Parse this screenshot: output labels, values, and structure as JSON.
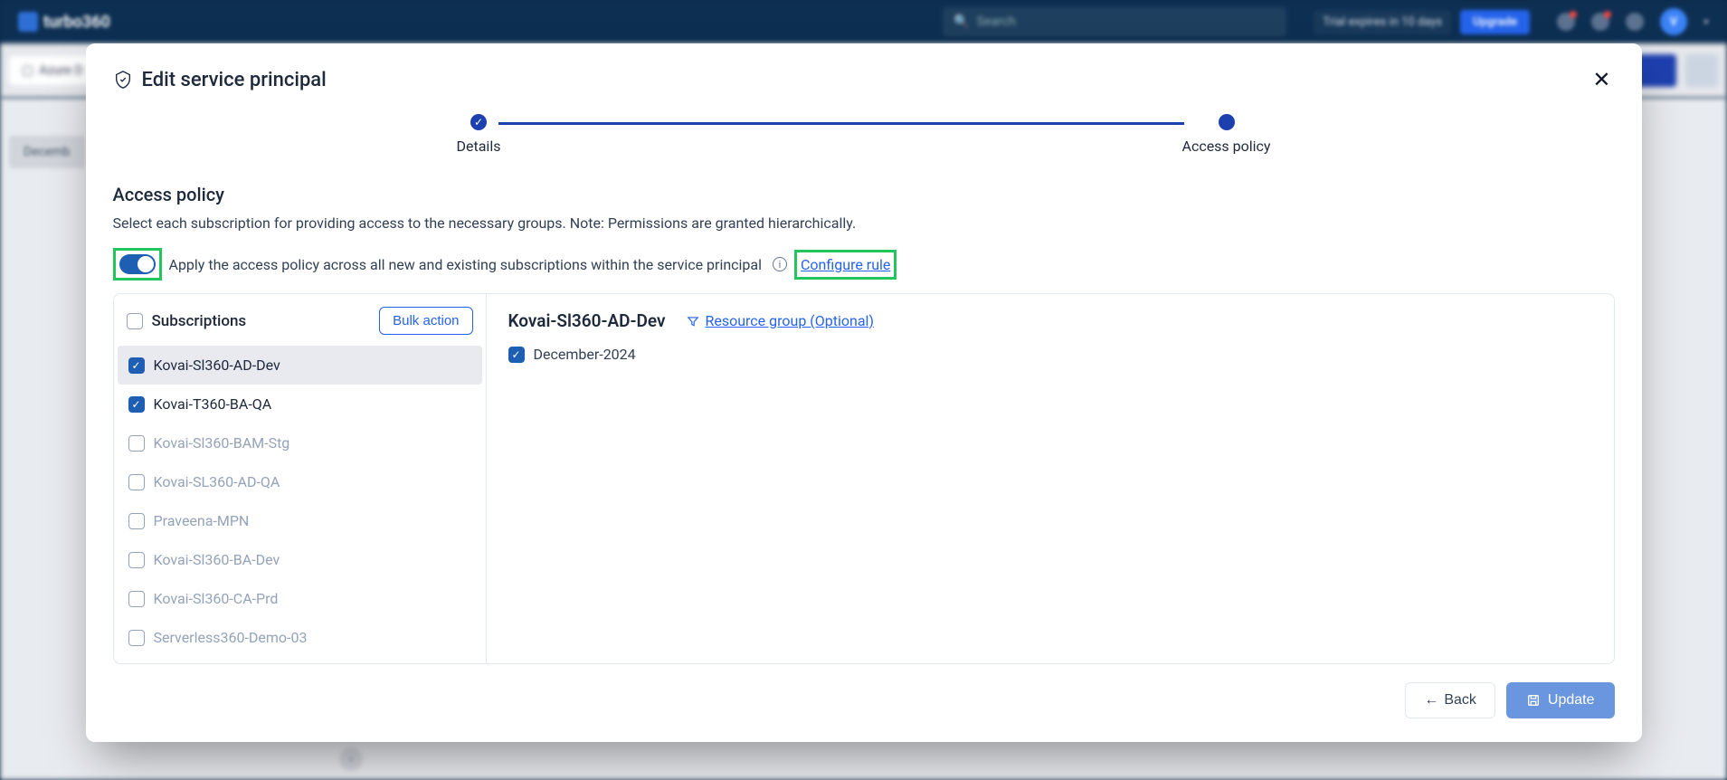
{
  "background": {
    "logo_text": "turbo360",
    "search_placeholder": "Search",
    "trial_text": "Trial expires in 10 days",
    "upgrade_label": "Upgrade",
    "avatar_initial": "V",
    "crumb": "Azure D",
    "sidebar_item": "Decemb",
    "collapse_icon": "‹"
  },
  "modal": {
    "title": "Edit service principal",
    "close_label": "✕",
    "stepper": {
      "step1": "Details",
      "step2": "Access policy"
    },
    "section": {
      "title": "Access policy",
      "desc": "Select each subscription for providing access to the necessary groups. Note: Permissions are granted hierarchically."
    },
    "toggle": {
      "text": "Apply the access policy across all new and existing subscriptions within the service principal",
      "info": "i",
      "configure": "Configure rule"
    },
    "left": {
      "header_label": "Subscriptions",
      "bulk_label": "Bulk action",
      "items": [
        {
          "label": "Kovai-Sl360-AD-Dev",
          "checked": true,
          "selected": true,
          "dim": false
        },
        {
          "label": "Kovai-T360-BA-QA",
          "checked": true,
          "selected": false,
          "dim": false
        },
        {
          "label": "Kovai-Sl360-BAM-Stg",
          "checked": false,
          "selected": false,
          "dim": true
        },
        {
          "label": "Kovai-SL360-AD-QA",
          "checked": false,
          "selected": false,
          "dim": true
        },
        {
          "label": "Praveena-MPN",
          "checked": false,
          "selected": false,
          "dim": true
        },
        {
          "label": "Kovai-Sl360-BA-Dev",
          "checked": false,
          "selected": false,
          "dim": true
        },
        {
          "label": "Kovai-Sl360-CA-Prd",
          "checked": false,
          "selected": false,
          "dim": true
        },
        {
          "label": "Serverless360-Demo-03",
          "checked": false,
          "selected": false,
          "dim": true
        }
      ]
    },
    "right": {
      "title": "Kovai-Sl360-AD-Dev",
      "resource_group_link": "Resource group (Optional)",
      "items": [
        {
          "label": "December-2024",
          "checked": true
        }
      ]
    },
    "footer": {
      "back_label": "Back",
      "update_label": "Update"
    }
  }
}
